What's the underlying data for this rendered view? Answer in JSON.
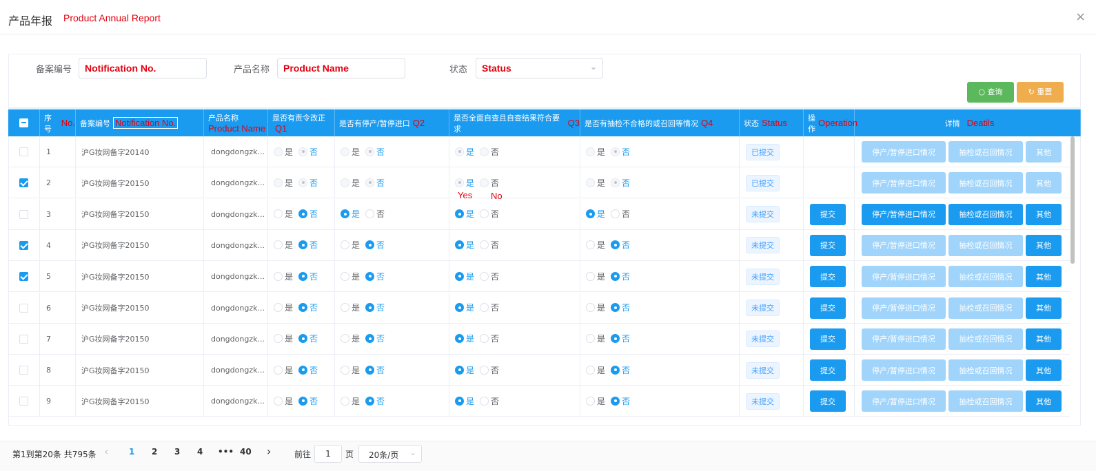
{
  "dialog": {
    "title": "产品年报",
    "title_en": "Product Annual Report",
    "close_icon": "×"
  },
  "filters": {
    "notification_label": "备案编号",
    "notification_value": "Notification No.",
    "name_label": "产品名称",
    "name_value": "Product Name",
    "status_label": "状态",
    "status_value": "Status"
  },
  "buttons": {
    "search": "查询",
    "reset": "重置",
    "search_icon": "○",
    "reset_icon": "↻"
  },
  "header": {
    "no": "序号",
    "no_en": "No.",
    "notification": "备案编号",
    "notification_en": "Notification No.",
    "name": "产品名称",
    "name_en": "Product Name",
    "q1": "是否有责令改正",
    "q1_en": "Q1",
    "q2": "是否有停产/暂停进口",
    "q2_en": "Q2",
    "q3": "是否全面自查且自查结果符合要求",
    "q3_en": "Q3",
    "q4": "是否有抽检不合格的或召回等情况",
    "q4_en": "Q4",
    "status": "状态",
    "status_en": "Status",
    "operation": "操作",
    "operation_en": "Operation",
    "details": "详情",
    "details_en": "Deatils"
  },
  "labels": {
    "yes": "是",
    "no": "否",
    "submit": "提交",
    "detail1": "停产/暂停进口情况",
    "detail2": "抽检或召回情况",
    "detail3": "其他"
  },
  "annotations": {
    "yes": "Yes",
    "no": "No"
  },
  "rows": [
    {
      "no": "1",
      "code": "沪G妆网备字20140",
      "name": "dongdongzk...",
      "checked": false,
      "q1": "no",
      "q2": "no",
      "q3": "yes",
      "q4": "no",
      "status": "已提交",
      "submitted": true
    },
    {
      "no": "2",
      "code": "沪G妆网备字20150",
      "name": "dongdongzk...",
      "checked": true,
      "q1": "no",
      "q2": "no",
      "q3": "yes",
      "q4": "no",
      "status": "已提交",
      "submitted": true
    },
    {
      "no": "3",
      "code": "沪G妆网备字20150",
      "name": "dongdongzk...",
      "checked": false,
      "q1": "no",
      "q2": "yes",
      "q3": "yes",
      "q4": "yes",
      "status": "未提交",
      "submitted": false,
      "detail_active": [
        true,
        true,
        true
      ]
    },
    {
      "no": "4",
      "code": "沪G妆网备字20150",
      "name": "dongdongzk...",
      "checked": true,
      "q1": "no",
      "q2": "no",
      "q3": "yes",
      "q4": "no",
      "status": "未提交",
      "submitted": false,
      "detail_active": [
        false,
        false,
        true
      ]
    },
    {
      "no": "5",
      "code": "沪G妆网备字20150",
      "name": "dongdongzk...",
      "checked": true,
      "q1": "no",
      "q2": "no",
      "q3": "yes",
      "q4": "no",
      "status": "未提交",
      "submitted": false,
      "detail_active": [
        false,
        false,
        true
      ]
    },
    {
      "no": "6",
      "code": "沪G妆网备字20150",
      "name": "dongdongzk...",
      "checked": false,
      "q1": "no",
      "q2": "no",
      "q3": "yes",
      "q4": "no",
      "status": "未提交",
      "submitted": false,
      "detail_active": [
        false,
        false,
        true
      ]
    },
    {
      "no": "7",
      "code": "沪G妆网备字20150",
      "name": "dongdongzk...",
      "checked": false,
      "q1": "no",
      "q2": "no",
      "q3": "yes",
      "q4": "no",
      "status": "未提交",
      "submitted": false,
      "detail_active": [
        false,
        false,
        true
      ]
    },
    {
      "no": "8",
      "code": "沪G妆网备字20150",
      "name": "dongdongzk...",
      "checked": false,
      "q1": "no",
      "q2": "no",
      "q3": "yes",
      "q4": "no",
      "status": "未提交",
      "submitted": false,
      "detail_active": [
        false,
        false,
        true
      ]
    },
    {
      "no": "9",
      "code": "沪G妆网备字20150",
      "name": "dongdongzk...",
      "checked": false,
      "q1": "no",
      "q2": "no",
      "q3": "yes",
      "q4": "no",
      "status": "未提交",
      "submitted": false,
      "detail_active": [
        false,
        false,
        true
      ]
    }
  ],
  "pagination": {
    "summary": "第1到第20条 共795条",
    "pages": [
      "1",
      "2",
      "3",
      "4",
      "•••",
      "40"
    ],
    "prev_icon": "‹",
    "next_icon": "›",
    "goto_label": "前往",
    "goto_value": "1",
    "page_suffix": "页",
    "page_size": "20条/页"
  },
  "colors": {
    "primary": "#1a9bf0",
    "search": "#5cb85c",
    "reset": "#f0ad4e",
    "annotation": "#e3000f"
  }
}
